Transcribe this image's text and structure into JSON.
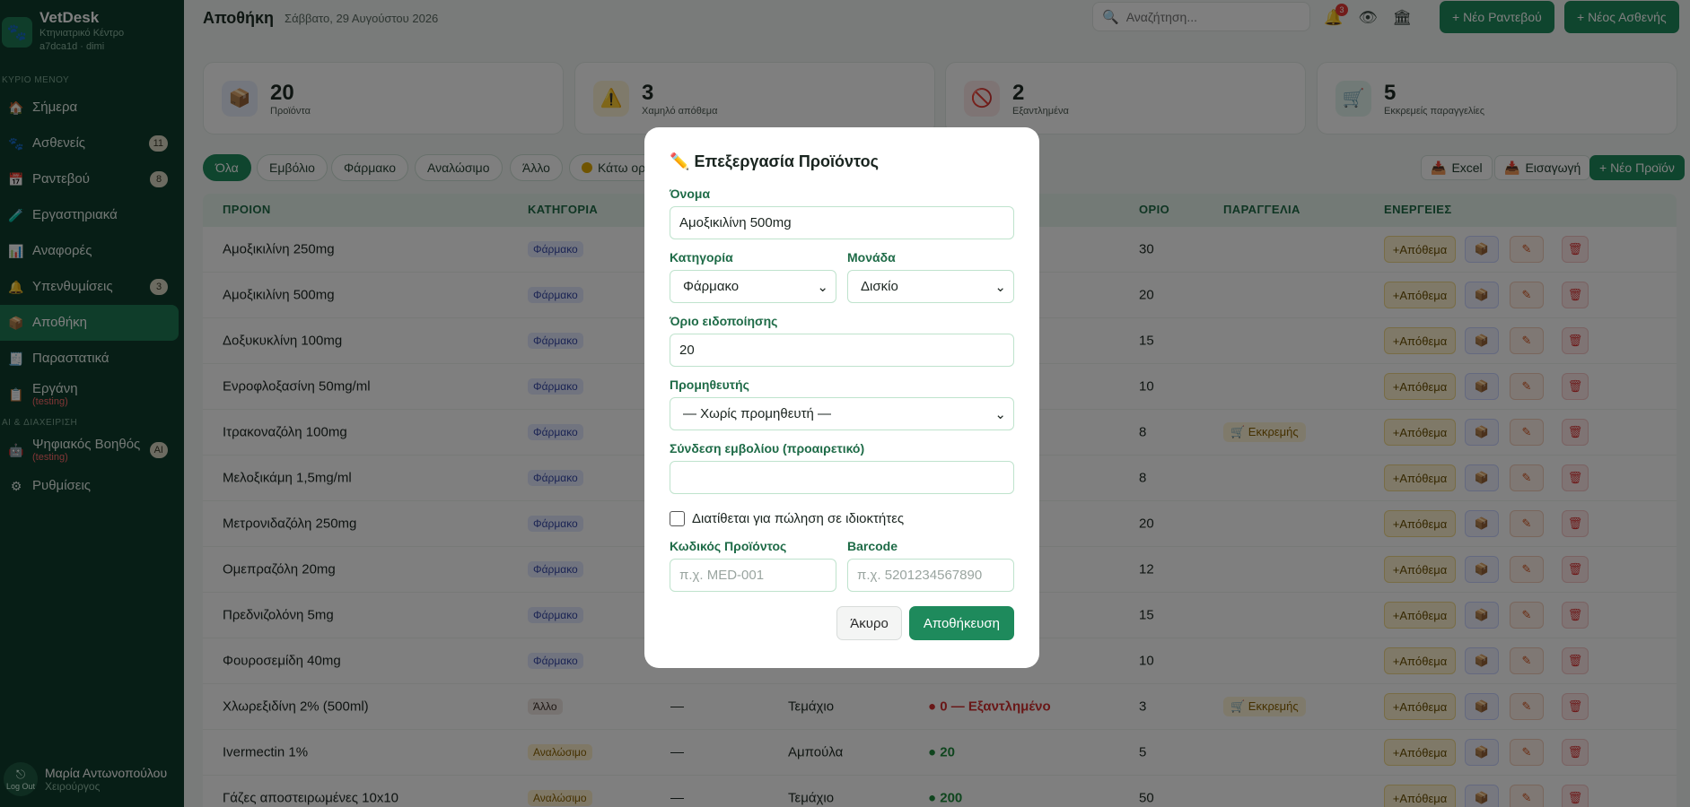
{
  "app": {
    "name": "VetDesk",
    "subtitle": "Κτηνιατρικό Κέντρο",
    "account": "a7dca1d · dimi"
  },
  "sidebar": {
    "section_main": "ΚΥΡΙΟ ΜΕΝΟΥ",
    "section_ai": "AI & ΔΙΑΧΕΙΡΙΣΗ",
    "items": [
      {
        "label": "Σήμερα",
        "icon": "🏠"
      },
      {
        "label": "Ασθενείς",
        "icon": "🐾",
        "badge": "11"
      },
      {
        "label": "Ραντεβού",
        "icon": "📅",
        "badge": "8"
      },
      {
        "label": "Εργαστηριακά",
        "icon": "🧪"
      },
      {
        "label": "Αναφορές",
        "icon": "📊"
      },
      {
        "label": "Υπενθυμίσεις",
        "icon": "🔔",
        "badge": "3"
      },
      {
        "label": "Αποθήκη",
        "icon": "📦"
      },
      {
        "label": "Παραστατικά",
        "icon": "🧾"
      },
      {
        "label": "Εργάνη",
        "icon": "📋",
        "sub": "(testing)"
      },
      {
        "label": "Ψηφιακός Βοηθός",
        "icon": "🤖",
        "sub": "(testing)",
        "badge": "AI"
      },
      {
        "label": "Ρυθμίσεις",
        "icon": "⚙"
      }
    ],
    "user": {
      "name": "Μαρία Αντωνοπούλου",
      "role": "Χειρούργος",
      "logout": "Log Out"
    }
  },
  "header": {
    "title": "Αποθήκη",
    "date": "Σάββατο, 29 Αυγούστου 2026",
    "search_placeholder": "Αναζήτηση...",
    "notif_count": "3",
    "btn_appointment": "+ Νέο Ραντεβού",
    "btn_patient": "+ Νέος Ασθενής"
  },
  "stats": [
    {
      "value": "20",
      "label": "Προϊόντα",
      "icon": "📦"
    },
    {
      "value": "3",
      "label": "Χαμηλό απόθεμα",
      "icon": "⚠️"
    },
    {
      "value": "2",
      "label": "Εξαντλημένα",
      "icon": "🚫"
    },
    {
      "value": "5",
      "label": "Εκκρεμείς παραγγελίες",
      "icon": "🛒"
    }
  ],
  "filters": {
    "chips": [
      "Όλα",
      "Εμβόλιο",
      "Φάρμακο",
      "Αναλώσιμο",
      "Άλλο",
      "Κάτω ορί"
    ],
    "btn_excel": "Excel",
    "btn_import": "Εισαγωγή",
    "btn_new": "+ Νέο Προϊόν"
  },
  "table": {
    "headers": [
      "ΠΡΟΙΟΝ",
      "ΚΑΤΗΓΟΡΙΑ",
      "ΟΡΙΟ",
      "ΠΑΡΑΓΓΕΛΙΑ",
      "ΕΝΕΡΓΕΙΕΣ"
    ],
    "action_stock": "+Απόθεμα",
    "rows": [
      {
        "name": "Αμοξικιλίνη 250mg",
        "cat": "Φάρμακο",
        "limit": "30",
        "order": ""
      },
      {
        "name": "Αμοξικιλίνη 500mg",
        "cat": "Φάρμακο",
        "limit": "20",
        "order": ""
      },
      {
        "name": "Δοξυκυκλίνη 100mg",
        "cat": "Φάρμακο",
        "limit": "15",
        "order": ""
      },
      {
        "name": "Ενροφλοξασίνη 50mg/ml",
        "cat": "Φάρμακο",
        "limit": "10",
        "order": ""
      },
      {
        "name": "Ιτρακοναζόλη 100mg",
        "cat": "Φάρμακο",
        "limit": "8",
        "order": "🛒 Εκκρεμής"
      },
      {
        "name": "Μελοξικάμη 1,5mg/ml",
        "cat": "Φάρμακο",
        "limit": "8",
        "order": ""
      },
      {
        "name": "Μετρονιδαζόλη 250mg",
        "cat": "Φάρμακο",
        "limit": "20",
        "order": ""
      },
      {
        "name": "Ομεπραζόλη 20mg",
        "cat": "Φάρμακο",
        "limit": "12",
        "order": ""
      },
      {
        "name": "Πρεδνιζολόνη 5mg",
        "cat": "Φάρμακο",
        "limit": "15",
        "order": ""
      },
      {
        "name": "Φουροσεμίδη 40mg",
        "cat": "Φάρμακο",
        "limit": "10",
        "order": ""
      },
      {
        "name": "Χλωρεξιδίνη 2% (500ml)",
        "cat": "Άλλο",
        "sup": "—",
        "unit": "Τεμάχιο",
        "stock": "● 0 — Εξαντλημένο",
        "stock_color": "#d32f2f",
        "limit": "3",
        "order": "🛒 Εκκρεμής"
      },
      {
        "name": "Ivermectin 1%",
        "cat": "Αναλώσιμο",
        "sup": "—",
        "unit": "Αμπούλα",
        "stock": "● 20",
        "stock_color": "#1e8a3c",
        "limit": "5",
        "order": ""
      },
      {
        "name": "Γάζες αποστειρωμένες 10x10",
        "cat": "Αναλώσιμο",
        "sup": "—",
        "unit": "Τεμάχιο",
        "stock": "● 200",
        "stock_color": "#1e8a3c",
        "limit": "50",
        "order": ""
      }
    ]
  },
  "modal": {
    "title": "Επεξεργασία Προϊόντος",
    "title_icon": "✏️",
    "name_label": "Όνομα",
    "name_value": "Αμοξικιλίνη 500mg",
    "category_label": "Κατηγορία",
    "category_value": "Φάρμακο",
    "unit_label": "Μονάδα",
    "unit_value": "Δισκίο",
    "threshold_label": "Όριο ειδοποίησης",
    "threshold_value": "20",
    "supplier_label": "Προμηθευτής",
    "supplier_value": "— Χωρίς προμηθευτή —",
    "vaccine_label": "Σύνδεση εμβολίου (προαιρετικό)",
    "vaccine_value": "",
    "sale_label": "Διατίθεται για πώληση σε ιδιοκτήτες",
    "code_label": "Κωδικός Προϊόντος",
    "code_placeholder": "π.χ. MED-001",
    "barcode_label": "Barcode",
    "barcode_placeholder": "π.χ. 5201234567890",
    "cancel": "Άκυρο",
    "save": "Αποθήκευση"
  }
}
